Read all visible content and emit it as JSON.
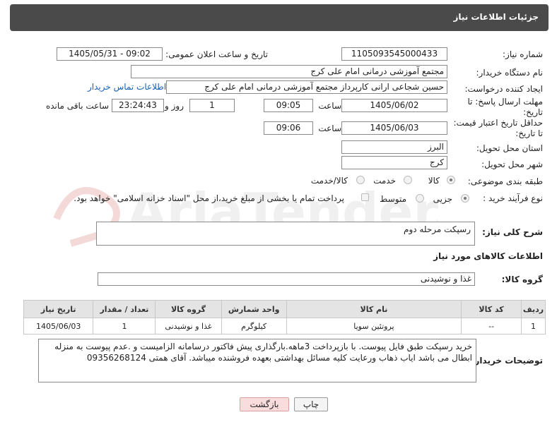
{
  "header": {
    "title": "جزئیات اطلاعات نیاز"
  },
  "form": {
    "need_number_label": "شماره نیاز:",
    "need_number": "1105093545000433",
    "announce_label": "تاریخ و ساعت اعلان عمومی:",
    "announce_value": "1405/05/31 - 09:02",
    "buyer_org_label": "نام دستگاه خریدار:",
    "buyer_org": "مجتمع آموزشی درمانی امام علی کرج",
    "requester_label": "ایجاد کننده درخواست:",
    "requester": "حسین شجاعی ارانی کارپرداز مجتمع آموزشی درمانی امام علی کرج",
    "contact_link": "اطلاعات تماس خریدار",
    "deadline_label_1": "مهلت ارسال پاسخ: تا",
    "deadline_label_2": "تاریخ:",
    "deadline_date": "1405/06/02",
    "time_label": "ساعت",
    "deadline_time": "09:05",
    "days_value": "1",
    "days_label": "روز و",
    "remaining_time": "23:24:43",
    "remaining_label": "ساعت باقی مانده",
    "price_label_1": "حداقل تاریخ اعتبار قیمت:",
    "price_label_2": "تا تاریخ:",
    "price_date": "1405/06/03",
    "price_time": "09:06",
    "province_label": "استان محل تحویل:",
    "province": "البرز",
    "city_label": "شهر محل تحویل:",
    "city": "کرج",
    "category_label": "طبقه بندی موضوعی:",
    "category_options": [
      "کالا",
      "خدمت",
      "کالا/خدمت"
    ],
    "process_label": "نوع فرآیند خرید :",
    "process_options": [
      "جزیی",
      "متوسط"
    ],
    "payment_note": "پرداخت تمام یا بخشی از مبلغ خرید،از محل \"اسناد خزانه اسلامی\" خواهد بود.",
    "description_label": "شرح کلی نیاز:",
    "description": "رسپکت مرحله دوم",
    "goods_info_label": "اطلاعات کالاهای مورد نیاز",
    "goods_group_label": "گروه کالا:",
    "goods_group": "غذا و نوشیدنی"
  },
  "table": {
    "headers": [
      "ردیف",
      "کد کالا",
      "نام کالا",
      "واحد شمارش",
      "گروه کالا",
      "تعداد / مقدار",
      "تاریخ نیاز"
    ],
    "rows": [
      [
        "1",
        "--",
        "پروتئین سویا",
        "کیلوگرم",
        "غذا و نوشیدنی",
        "1",
        "1405/06/03"
      ]
    ]
  },
  "buyer_notes_label": "توضیحات خریدار:",
  "buyer_notes": "خرید رسپکت طبق فایل پیوست. با بازپرداخت 3ماهه.بارگذاری پیش فاکتور درسامانه الزامیست و .عدم پیوست به منزله ابطال می باشد ایاب ذهاب ورعایت کلیه مسائل بهداشتی بعهده فروشنده میباشد. آقای همتی 09356268124",
  "buttons": {
    "print": "چاپ",
    "back": "بازگشت"
  },
  "watermark_text": "AriaTender.neT"
}
